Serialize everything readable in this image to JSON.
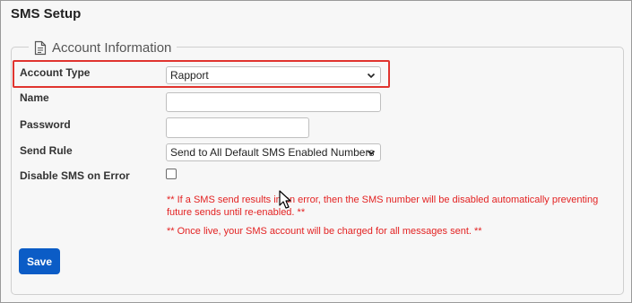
{
  "page": {
    "title": "SMS Setup"
  },
  "section": {
    "legend": "Account Information",
    "icon": "document-icon"
  },
  "form": {
    "account_type": {
      "label": "Account Type",
      "value": "Rapport"
    },
    "name": {
      "label": "Name",
      "value": ""
    },
    "password": {
      "label": "Password",
      "value": ""
    },
    "send_rule": {
      "label": "Send Rule",
      "value": "Send to All Default SMS Enabled Numbers"
    },
    "disable_on_error": {
      "label": "Disable SMS on Error",
      "checked": false
    }
  },
  "notes": {
    "disable_note": "** If a SMS send results in an error, then the SMS number will be disabled automatically preventing future sends until re-enabled. **",
    "charge_note": "** Once live, your SMS account will be charged for all messages sent. **"
  },
  "actions": {
    "save_label": "Save"
  },
  "colors": {
    "accent": "#0b5cc6",
    "highlight": "#e0342f",
    "note": "#e32222"
  }
}
